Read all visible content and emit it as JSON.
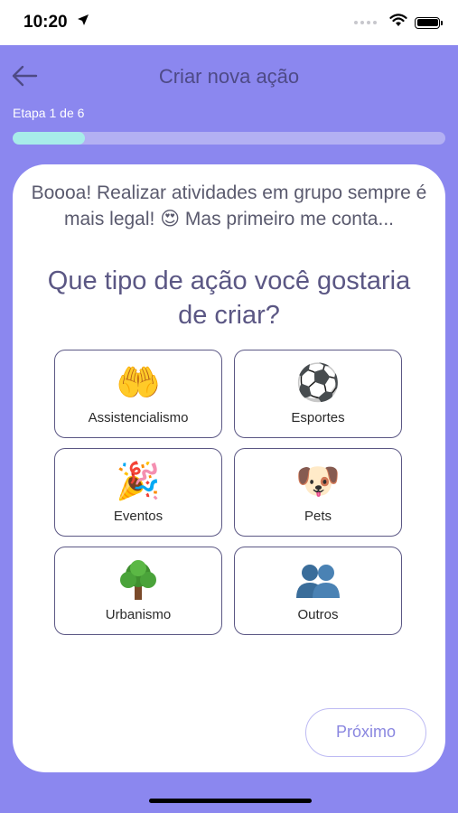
{
  "status": {
    "time": "10:20"
  },
  "header": {
    "title": "Criar nova ação"
  },
  "progress": {
    "label": "Etapa 1 de 6",
    "fraction": 0.167
  },
  "card": {
    "intro": "Boooa! Realizar atividades em grupo sempre é mais legal! 😍 Mas primeiro me conta...",
    "question": "Que tipo de ação você gostaria de criar?",
    "options": [
      {
        "label": "Assistencialismo",
        "icon": "open-hands-icon"
      },
      {
        "label": "Esportes",
        "icon": "soccer-ball-icon"
      },
      {
        "label": "Eventos",
        "icon": "party-popper-icon"
      },
      {
        "label": "Pets",
        "icon": "dog-face-icon"
      },
      {
        "label": "Urbanismo",
        "icon": "tree-icon"
      },
      {
        "label": "Outros",
        "icon": "people-icon"
      }
    ],
    "next_label": "Próximo"
  },
  "colors": {
    "background": "#8b87ef",
    "title": "#4e4a86",
    "progress_fill": "#a7ece9",
    "progress_track": "#b3b0f3",
    "next_button_text": "#8a87e0"
  }
}
